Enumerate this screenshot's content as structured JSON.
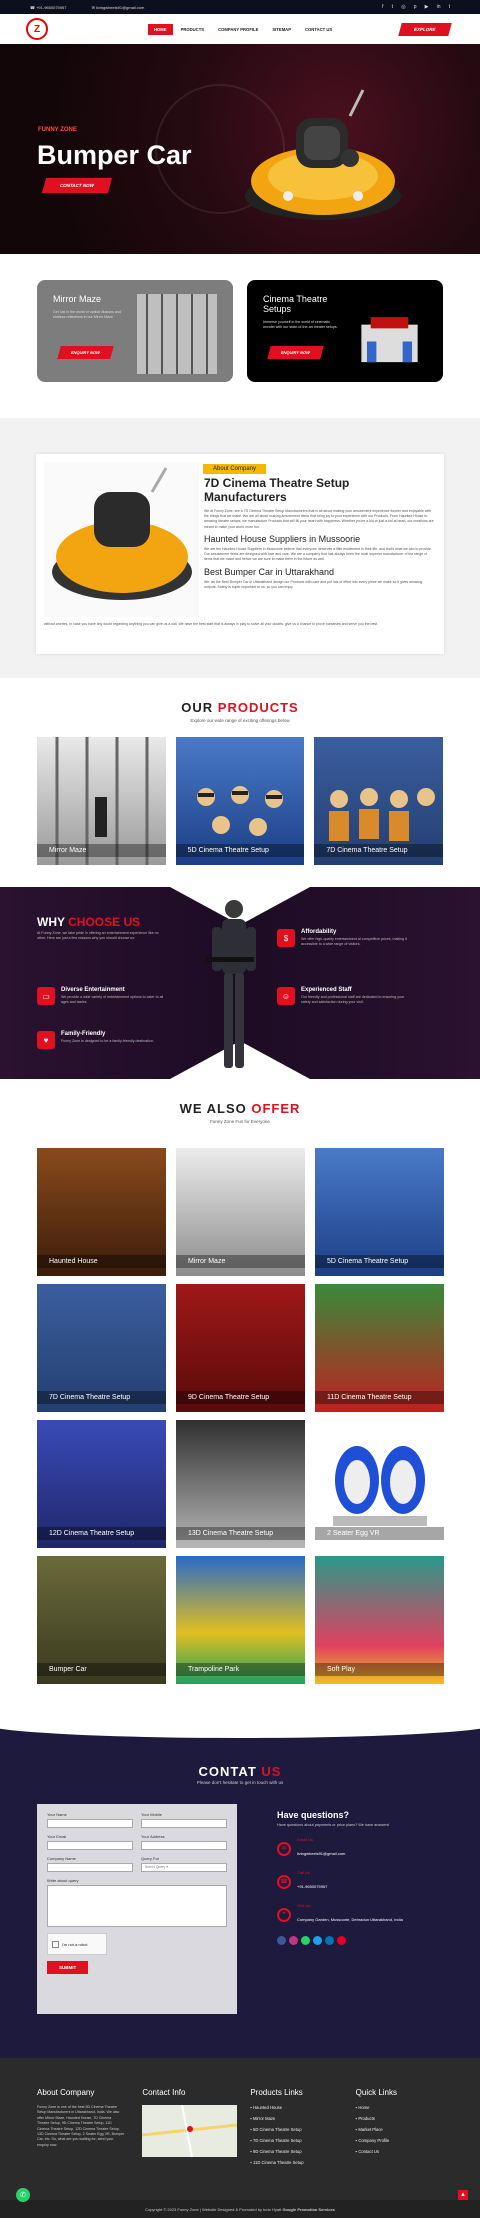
{
  "topbar": {
    "phone": "+91-9650075957",
    "email": "livingwheels91@gmail.com",
    "social_icons": [
      "facebook-icon",
      "twitter-icon",
      "instagram-icon",
      "pinterest-icon",
      "youtube-icon",
      "linkedin-icon",
      "tumblr-icon"
    ]
  },
  "nav": {
    "logo_text": "Z",
    "items": [
      "HOME",
      "PRODUCTS",
      "COMPANY PROFILE",
      "SITEMAP",
      "CONTACT US"
    ],
    "explore": "EXPLORE"
  },
  "hero": {
    "kicker": "FUNNY ZONE",
    "title": "Bumper Car",
    "button": "CONTACT NOW"
  },
  "cards": [
    {
      "title": "Mirror Maze",
      "desc": "Get lost in the world of optical illusions and endless reflections in our Mirror Maze.",
      "button": "ENQUIRY NOW"
    },
    {
      "title": "Cinema Theatre Setups",
      "desc": "Immerse yourself in the world of cinematic wonder with our state-of-the-art theater setups.",
      "button": "ENQUIRY NOW"
    }
  ],
  "about": {
    "tag": "About Company",
    "title": "7D Cinema Theatre Setup Manufacturers",
    "p1": "We at Funny Zone, are a 7D Cinema Theatre Setup Manufacturers that is all about making your amusement experience funnier and enjoyable with the things that we make. We are all about making amusement items that bring joy to your experience with our Products. From Haunted House to amazing theatre setups, we manufacture Products that will fill your heart with happiness. Whether you're a kid or just a kid at heart, our creations are meant to make your world more fun.",
    "h2": "Haunted House Suppliers in Mussoorie",
    "p2": "We are the Haunted House Suppliers in Mussoorie believe that everyone deserves a little excitement in their life, and that's what we aim to provide. Our amusement items are designed with love and care. We are a company that has always been the most superior manufacturer of the range of items that we make and hence we are sure to make them in the future as well.",
    "h3": "Best Bumper Car in Uttarakhand",
    "p3": "We, as the Best Bumper Car in Uttarakhand design our Products with care and put lots of effort into every piece we make so it gives amazing outputs. Safety is super important to us, so you can enjoy",
    "p3b": "without worries. In case you have any doubt regarding anything you can give us a call. We have the best staff that is always in play to solve all your doubts; give us a chance to prove ourselves and serve you the best."
  },
  "products": {
    "title_a": "OUR",
    "title_b": "PRODUCTS",
    "sub": "Explore our wide range of exciting offerings below",
    "items": [
      "Mirror Maze",
      "5D Cinema Theatre Setup",
      "7D Cinema Theatre Setup"
    ]
  },
  "why": {
    "title_a": "WHY",
    "title_b": "CHOOSE US",
    "intro": "At Funny Zone, we take pride in offering an entertainment experience like no other. Here are just a few reasons why you should choose us:",
    "features": [
      {
        "title": "Affordability",
        "desc": "We offer high-quality entertainment at competitive prices, making it accessible to a wide range of visitors.",
        "icon": "money-icon"
      },
      {
        "title": "Diverse Entertainment",
        "desc": "We provide a wide variety of entertainment options to cater to all ages and tastes.",
        "icon": "ticket-icon"
      },
      {
        "title": "Experienced Staff",
        "desc": "Our friendly and professional staff are dedicated to ensuring your safety and satisfaction during your visit.",
        "icon": "staff-icon"
      },
      {
        "title": "Family-Friendly",
        "desc": "Funny Zone is designed to be a family-friendly destination.",
        "icon": "family-icon"
      }
    ]
  },
  "offer": {
    "title_a": "WE ALSO",
    "title_b": "OFFER",
    "sub": "Funny Zone Fun for Everyone",
    "items": [
      "Haunted House",
      "Mirror Maze",
      "5D Cinema Theatre Setup",
      "7D Cinema Theatre Setup",
      "9D Cinema Theatre Setup",
      "11D Cinema Theatre Setup",
      "12D Cinema Theatre Setup",
      "13D Cinema Theatre Setup",
      "2 Seater Egg VR",
      "Bumper Car",
      "Trampoline Park",
      "Soft Play"
    ]
  },
  "contact": {
    "title_a": "CONTAT",
    "title_b": "US",
    "sub": "Please don't hesitate to get in touch with us",
    "fields": {
      "name": "Your Name",
      "mobile": "Your Mobile",
      "email": "Your Email",
      "address": "Your Address",
      "company": "Company Name",
      "query": "Query For",
      "query_placeholder": "Select Query",
      "write": "Write about query"
    },
    "captcha": "I'm not a robot",
    "submit": "SUBMIT",
    "info_title": "Have questions?",
    "info_sub": "Have questions about payments or price plans? We have answers!",
    "email_label": "Email Us",
    "email": "livingwheels91@gmail.com",
    "call_label": "Call Us",
    "phone": "+91-9650075957",
    "visit_label": "Visit Us",
    "address": "Company Garden, Mussoorie, Dehradun Uttarakhand, India"
  },
  "footer": {
    "about_title": "About Company",
    "about_text": "Funny Zone is one of the best 5D Cinema Theatre Setup Manufacturers in Uttarakhand, India. We also offer Mirror Maze, Haunted House, 7D Cinema Theatre Setup, 9D Cinema Theatre Setup, 11D Cinema Theatre Setup, 12D Cinema Theatre Setup, 13D Cinema Theatre Setup, 2 Seater Egg VR, Bumper Car, etc. So, what are you waiting for; send your enquiry now.",
    "contact_title": "Contact Info",
    "products_title": "Products Links",
    "product_links": [
      "Haunted House",
      "Mirror Maze",
      "5D Cinema Theatre Setup",
      "7D Cinema Theatre Setup",
      "9D Cinema Theatre Setup",
      "11D Cinema Theatre Setup"
    ],
    "quick_title": "Quick Links",
    "quick_links": [
      "Home",
      "Products",
      "Market Place",
      "Company Profile",
      "Contact Us"
    ],
    "copyright": "Copyright © 2023 Funny Zone | Website Designed & Promoted by Indo Hyatt",
    "promo": "Google Promotion Services"
  },
  "colors": {
    "accent": "#e01020",
    "dark_navy": "#1d1a3e",
    "purple": "#2a1230"
  }
}
